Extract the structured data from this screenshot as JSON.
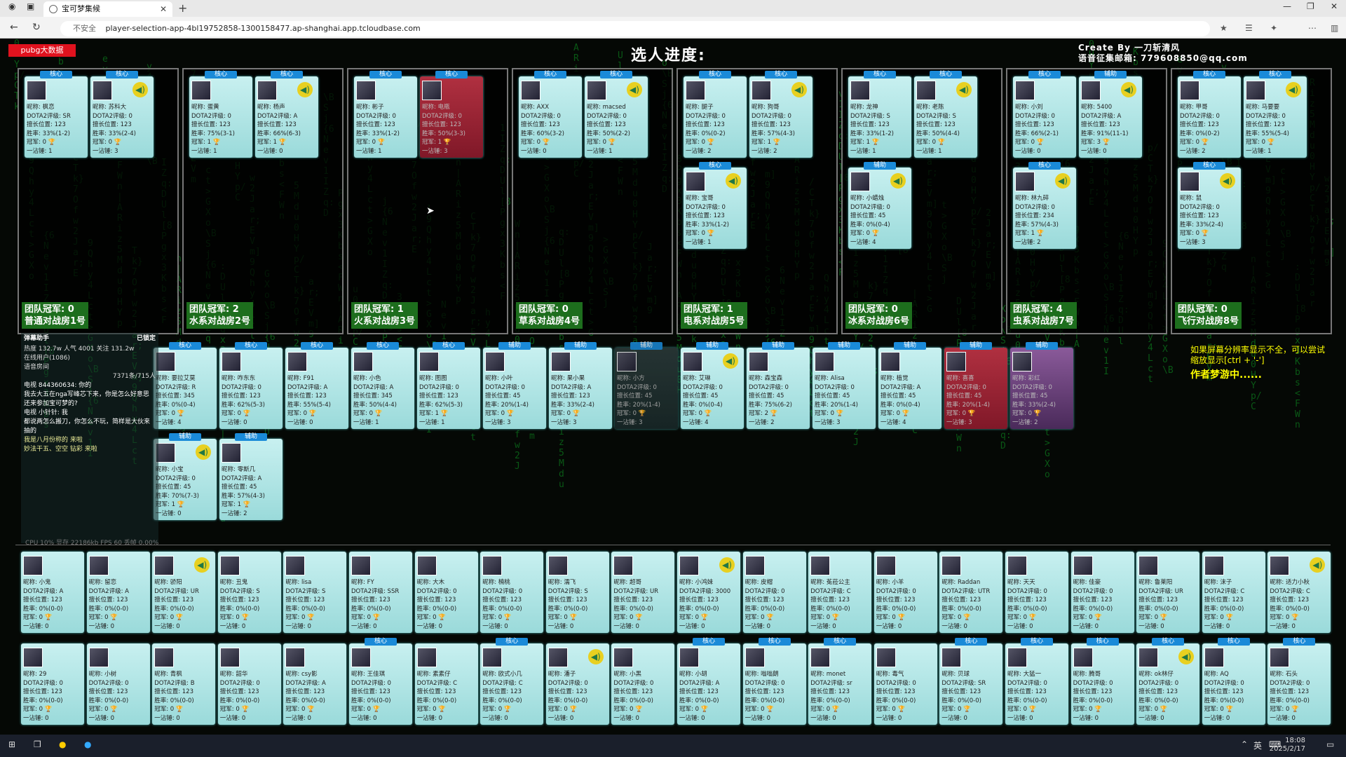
{
  "browser": {
    "tab_title": "宝可梦集候",
    "url": "player-selection-app-4bl19752858-1300158477.ap-shanghai.app.tcloudbase.com",
    "insecure": "不安全"
  },
  "header": {
    "title": "选人进度:",
    "credit_1": "Create By 一刀斩清风",
    "credit_2": "语音征集邮箱: 779608850@qq.com",
    "pubg": "pubg大数据"
  },
  "rooms": [
    {
      "label1": "团队冠军: 0",
      "label2": "普通对战房1号"
    },
    {
      "label1": "团队冠军: 2",
      "label2": "水系对战房2号"
    },
    {
      "label1": "团队冠军: 1",
      "label2": "火系对战房3号"
    },
    {
      "label1": "团队冠军: 0",
      "label2": "草系对战房4号"
    },
    {
      "label1": "团队冠军: 1",
      "label2": "电系对战房5号"
    },
    {
      "label1": "团队冠军: 0",
      "label2": "冰系对战房6号"
    },
    {
      "label1": "团队冠军: 4",
      "label2": "虫系对战房7号"
    },
    {
      "label1": "团队冠军: 0",
      "label2": "飞行对战房8号"
    }
  ],
  "room_cards": [
    [
      {
        "role": "核心",
        "name": "昵称: 枫恋",
        "rank": "DOTA2评级: SR",
        "pos": "擅长位置: 123",
        "win": "胜率: 33%(1-2)",
        "champ": "冠军: 0",
        "one": "一沾锤: 1"
      },
      {
        "role": "核心",
        "name": "昵称: 苏科大",
        "rank": "DOTA2评级: 0",
        "pos": "擅长位置: 123",
        "win": "胜率: 33%(2-4)",
        "champ": "冠军: 0",
        "one": "一沾锤: 3"
      }
    ],
    [
      {
        "role": "核心",
        "name": "昵称: 蛋黄",
        "rank": "DOTA2评级: 0",
        "pos": "擅长位置: 123",
        "win": "胜率: 75%(3-1)",
        "champ": "冠军: 1",
        "one": "一沾锤: 1"
      },
      {
        "role": "核心",
        "name": "昵称: 杨声",
        "rank": "DOTA2评级: A",
        "pos": "擅长位置: 123",
        "win": "胜率: 66%(6-3)",
        "champ": "冠军: 1",
        "one": "一沾锤: 0"
      }
    ],
    [
      {
        "role": "核心",
        "name": "昵称: 彬子",
        "rank": "DOTA2评级: 0",
        "pos": "擅长位置: 123",
        "win": "胜率: 33%(1-2)",
        "champ": "冠军: 0",
        "one": "一沾锤: 1"
      },
      {
        "role": "核心",
        "name": "昵称: 电瓶",
        "rank": "DOTA2评级: 0",
        "pos": "擅长位置: 123",
        "win": "胜率: 50%(3-3)",
        "champ": "冠军: 1",
        "one": "一沾锤: 3"
      }
    ],
    [
      {
        "role": "核心",
        "name": "昵称: AXX",
        "rank": "DOTA2评级: 0",
        "pos": "擅长位置: 123",
        "win": "胜率: 60%(3-2)",
        "champ": "冠军: 0",
        "one": "一沾锤: 0"
      },
      {
        "role": "核心",
        "name": "昵称: macsed",
        "rank": "DOTA2评级: 0",
        "pos": "擅长位置: 123",
        "win": "胜率: 50%(2-2)",
        "champ": "冠军: 0",
        "one": "一沾锤: 1"
      }
    ],
    [
      {
        "role": "核心",
        "name": "昵称: 腿子",
        "rank": "DOTA2评级: 0",
        "pos": "擅长位置: 123",
        "win": "胜率: 0%(0-2)",
        "champ": "冠军: 0",
        "one": "一沾锤: 2"
      },
      {
        "role": "核心",
        "name": "昵称: 狗哥",
        "rank": "DOTA2评级: 0",
        "pos": "擅长位置: 123",
        "win": "胜率: 57%(4-3)",
        "champ": "冠军: 1",
        "one": "一沾锤: 2"
      },
      {
        "role": "核心",
        "name": "昵称: 宝哥",
        "rank": "DOTA2评级: 0",
        "pos": "擅长位置: 123",
        "win": "胜率: 33%(1-2)",
        "champ": "冠军: 0",
        "one": "一沾锤: 1"
      }
    ],
    [
      {
        "role": "核心",
        "name": "昵称: 龙神",
        "rank": "DOTA2评级: S",
        "pos": "擅长位置: 123",
        "win": "胜率: 33%(1-2)",
        "champ": "冠军: 1",
        "one": "一沾锤: 1"
      },
      {
        "role": "核心",
        "name": "昵称: 老陈",
        "rank": "DOTA2评级: S",
        "pos": "擅长位置: 123",
        "win": "胜率: 50%(4-4)",
        "champ": "冠军: 0",
        "one": "一沾锤: 1"
      },
      {
        "role": "辅助",
        "name": "昵称: 小蜡烛",
        "rank": "DOTA2评级: 0",
        "pos": "擅长位置: 45",
        "win": "胜率: 0%(0-4)",
        "champ": "冠军: 0",
        "one": "一沾锤: 4"
      }
    ],
    [
      {
        "role": "核心",
        "name": "昵称: 小刘",
        "rank": "DOTA2评级: 0",
        "pos": "擅长位置: 123",
        "win": "胜率: 66%(2-1)",
        "champ": "冠军: 0",
        "one": "一沾锤: 0"
      },
      {
        "role": "辅助",
        "name": "昵称: 5400",
        "rank": "DOTA2评级: A",
        "pos": "擅长位置: 123",
        "win": "胜率: 91%(11-1)",
        "champ": "冠军: 3",
        "one": "一沾锤: 0"
      },
      {
        "role": "核心",
        "name": "昵称: 林九碎",
        "rank": "DOTA2评级: 0",
        "pos": "擅长位置: 234",
        "win": "胜率: 57%(4-3)",
        "champ": "冠军: 1",
        "one": "一沾锤: 2"
      }
    ],
    [
      {
        "role": "核心",
        "name": "昵称: 甲哥",
        "rank": "DOTA2评级: 0",
        "pos": "擅长位置: 123",
        "win": "胜率: 0%(0-2)",
        "champ": "冠军: 0",
        "one": "一沾锤: 2"
      },
      {
        "role": "核心",
        "name": "昵称: 马要要",
        "rank": "DOTA2评级: 0",
        "pos": "擅长位置: 123",
        "win": "胜率: 55%(5-4)",
        "champ": "冠军: 0",
        "one": "一沾锤: 1"
      },
      {
        "role": "核心",
        "name": "昵称: 鼠",
        "rank": "DOTA2评级: 0",
        "pos": "擅长位置: 123",
        "win": "胜率: 33%(2-4)",
        "champ": "冠军: 0",
        "one": "一沾锤: 3"
      }
    ]
  ],
  "middle_cards": [
    {
      "role": "核心",
      "name": "昵称: 要拉艾莫",
      "rank": "DOTA2评级: R",
      "pos": "擅长位置: 345",
      "win": "胜率: 0%(0-4)",
      "champ": "冠军: 0",
      "one": "一沾锤: 4",
      "style": "norm"
    },
    {
      "role": "核心",
      "name": "昵称: 咋东东",
      "rank": "DOTA2评级: 0",
      "pos": "擅长位置: 123",
      "win": "胜率: 62%(5-3)",
      "champ": "冠军: 0",
      "one": "一沾锤: 0",
      "style": "norm"
    },
    {
      "role": "核心",
      "name": "昵称: F91",
      "rank": "DOTA2评级: A",
      "pos": "擅长位置: 123",
      "win": "胜率: 55%(5-4)",
      "champ": "冠军: 0",
      "one": "一沾锤: 0",
      "style": "norm"
    },
    {
      "role": "核心",
      "name": "昵称: 小色",
      "rank": "DOTA2评级: A",
      "pos": "擅长位置: 345",
      "win": "胜率: 50%(4-4)",
      "champ": "冠军: 0",
      "one": "一沾锤: 1",
      "style": "norm"
    },
    {
      "role": "核心",
      "name": "昵称: 图图",
      "rank": "DOTA2评级: 0",
      "pos": "擅长位置: 123",
      "win": "胜率: 62%(5-3)",
      "champ": "冠军: 1",
      "one": "一沾锤: 1",
      "style": "norm"
    },
    {
      "role": "辅助",
      "name": "昵称: 小叶",
      "rank": "DOTA2评级: 0",
      "pos": "擅长位置: 45",
      "win": "胜率: 20%(1-4)",
      "champ": "冠军: 0",
      "one": "一沾锤: 3",
      "style": "norm"
    },
    {
      "role": "辅助",
      "name": "昵称: 果小果",
      "rank": "DOTA2评级: A",
      "pos": "擅长位置: 123",
      "win": "胜率: 33%(2-4)",
      "champ": "冠军: 0",
      "one": "一沾锤: 3",
      "style": "norm"
    },
    {
      "role": "辅助",
      "name": "昵称: 小方",
      "rank": "DOTA2评级: 0",
      "pos": "擅长位置: 45",
      "win": "胜率: 20%(1-4)",
      "champ": "冠军: 0",
      "one": "一沾锤: 3",
      "style": "dim"
    },
    {
      "role": "辅助",
      "name": "昵称: 艾琳",
      "rank": "DOTA2评级: 0",
      "pos": "擅长位置: 45",
      "win": "胜率: 0%(0-4)",
      "champ": "冠军: 0",
      "one": "一沾锤: 4",
      "style": "norm"
    },
    {
      "role": "辅助",
      "name": "昵称: 森宝森",
      "rank": "DOTA2评级: 0",
      "pos": "擅长位置: 45",
      "win": "胜率: 75%(6-2)",
      "champ": "冠军: 2",
      "one": "一沾锤: 2",
      "style": "norm"
    },
    {
      "role": "辅助",
      "name": "昵称: Alisa",
      "rank": "DOTA2评级: 0",
      "pos": "擅长位置: 45",
      "win": "胜率: 20%(1-4)",
      "champ": "冠军: 0",
      "one": "一沾锤: 3",
      "style": "norm"
    },
    {
      "role": "辅助",
      "name": "昵称: 植觉",
      "rank": "DOTA2评级: A",
      "pos": "擅长位置: 45",
      "win": "胜率: 0%(0-4)",
      "champ": "冠军: 0",
      "one": "一沾锤: 4",
      "style": "norm"
    },
    {
      "role": "辅助",
      "name": "昵称: 喜喜",
      "rank": "DOTA2评级: 0",
      "pos": "擅长位置: 45",
      "win": "胜率: 20%(1-4)",
      "champ": "冠军: 0",
      "one": "一沾锤: 3",
      "style": "red"
    },
    {
      "role": "辅助",
      "name": "昵称: 彩红",
      "rank": "DOTA2评级: 0",
      "pos": "擅长位置: 45",
      "win": "胜率: 33%(2-4)",
      "champ": "冠军: 0",
      "one": "一沾锤: 2",
      "style": "purple"
    }
  ],
  "middle_row2": [
    {
      "role": "辅助",
      "name": "昵称: 小宝",
      "rank": "DOTA2评级: 0",
      "pos": "擅长位置: 45",
      "win": "胜率: 70%(7-3)",
      "champ": "冠军: 1",
      "one": "一沾锤: 0"
    },
    {
      "role": "辅助",
      "name": "昵称: 零斯几",
      "rank": "DOTA2评级: A",
      "pos": "擅长位置: 45",
      "win": "胜率: 57%(4-3)",
      "champ": "冠军: 1",
      "one": "一沾锤: 2"
    }
  ],
  "stream_overlay": {
    "l1": "弹幕助手",
    "l2": "已锁定",
    "l3": "热度 132.7w  人气 4001  关注 131.2w",
    "l4": "在线用户(1086)",
    "l5": "语音房间",
    "l6": "7371条/715人",
    "l7": "电视  844360634: 你的",
    "l8": "我去大五在nga写峰芯下来，你是怎么好意思",
    "l9": "还来参加宝可梦的?",
    "l10": "电视  小针针: 我",
    "l11": "都说两怎么搬刀，你怎么不玩，简样是大伙来",
    "l12": "抽的",
    "l13": "我是八月份称的 来啦",
    "l14": "妙法干五、空空 钻彩 来啦"
  },
  "perf": "CPU 10%  显存 22186kb  FPS 60  丢帧 0.00%",
  "hint": {
    "line1": "如果屏幕分辨率显示不全，可以尝试缩放显示[ctrl + '-']",
    "line2": "作者梦游中......"
  },
  "pool_row1": [
    {
      "name": "昵称: 小鬼",
      "rank": "DOTA2评级: A"
    },
    {
      "name": "昵称: 留恋",
      "rank": "DOTA2评级: A"
    },
    {
      "name": "昵称: 骄阳",
      "rank": "DOTA2评级: UR"
    },
    {
      "name": "昵称: 丑鬼",
      "rank": "DOTA2评级: S"
    },
    {
      "name": "昵称: lisa",
      "rank": "DOTA2评级: S"
    },
    {
      "name": "昵称: FY",
      "rank": "DOTA2评级: SSR"
    },
    {
      "name": "昵称: 大木",
      "rank": "DOTA2评级: 0"
    },
    {
      "name": "昵称: 楠桃",
      "rank": "DOTA2评级: 0"
    },
    {
      "name": "昵称: 濡飞",
      "rank": "DOTA2评级: S"
    },
    {
      "name": "昵称: 超哥",
      "rank": "DOTA2评级: UR"
    },
    {
      "name": "昵称: 小鸿妹",
      "rank": "DOTA2评级: 3000"
    },
    {
      "name": "昵称: 皮帽",
      "rank": "DOTA2评级: 0"
    },
    {
      "name": "昵称: 菟菈公主",
      "rank": "DOTA2评级: C"
    },
    {
      "name": "昵称: 小羊",
      "rank": "DOTA2评级: 0"
    },
    {
      "name": "昵称: Raddan",
      "rank": "DOTA2评级: UTR"
    },
    {
      "name": "昵称: 天天",
      "rank": "DOTA2评级: 0"
    },
    {
      "name": "昵称: 佳豪",
      "rank": "DOTA2评级: 0"
    },
    {
      "name": "昵称: 鲁莱阳",
      "rank": "DOTA2评级: UR"
    },
    {
      "name": "昵称: 沫子",
      "rank": "DOTA2评级: C"
    },
    {
      "name": "昵称: 适力小秋",
      "rank": "DOTA2评级: C"
    }
  ],
  "pool_row2": [
    {
      "name": "昵称: 29",
      "rank": "DOTA2评级: 0"
    },
    {
      "name": "昵称: 小树",
      "rank": "DOTA2评级: 0"
    },
    {
      "name": "昵称: 青枫",
      "rank": "DOTA2评级: B"
    },
    {
      "name": "昵称: 韶华",
      "rank": "DOTA2评级: 0"
    },
    {
      "name": "昵称: csy影",
      "rank": "DOTA2评级: A"
    },
    {
      "name": "昵称: 王佳琪",
      "rank": "DOTA2评级: 0"
    },
    {
      "name": "昵称: 素素仔",
      "rank": "DOTA2评级: C"
    },
    {
      "name": "昵称: 欧式小几",
      "rank": "DOTA2评级: C"
    },
    {
      "name": "昵称: 潘子",
      "rank": "DOTA2评级: 0"
    },
    {
      "name": "昵称: 小黑",
      "rank": "DOTA2评级: 0"
    },
    {
      "name": "昵称: 小胡",
      "rank": "DOTA2评级: A"
    },
    {
      "name": "昵称: 嗡嗡朗",
      "rank": "DOTA2评级: 0"
    },
    {
      "name": "昵称: monet",
      "rank": "DOTA2评级: sr"
    },
    {
      "name": "昵称: 毒气",
      "rank": "DOTA2评级: 0"
    },
    {
      "name": "昵称: 贝球",
      "rank": "DOTA2评级: SR"
    },
    {
      "name": "昵称: 大猛一",
      "rank": "DOTA2评级: 0"
    },
    {
      "name": "昵称: 腾哥",
      "rank": "DOTA2评级: 0"
    },
    {
      "name": "昵称: ok林仔",
      "rank": "DOTA2评级: 0"
    },
    {
      "name": "昵称: AQ",
      "rank": "DOTA2评级: 0"
    },
    {
      "name": "昵称: 石头",
      "rank": "DOTA2评级: 0"
    }
  ],
  "pool_stats": {
    "pos": "擅长位置: 123",
    "win": "胜率: 0%(0-0)",
    "champ": "冠军: 0",
    "one": "一沾锤: 0"
  },
  "roles": {
    "core": "核心",
    "support": "辅助"
  },
  "taskbar": {
    "time": "18:08",
    "date": "2025/2/17",
    "lang": "英"
  },
  "colors": {
    "card": "#b8e8e8",
    "accent": "#1a8ad8",
    "room_label": "#1d6e1d",
    "rain": "#0b6b1a"
  }
}
